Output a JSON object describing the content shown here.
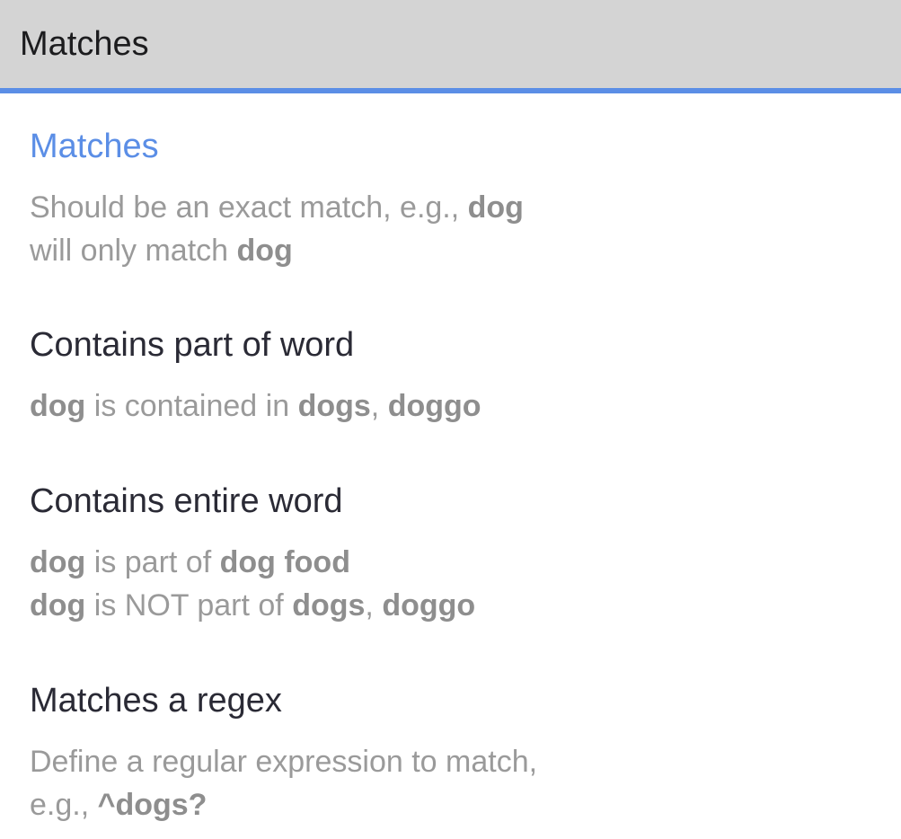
{
  "header": {
    "title": "Matches"
  },
  "accent_color": "#5b8ee6",
  "options": [
    {
      "title": "Matches",
      "selected": true,
      "desc_lines": [
        [
          {
            "t": "Should be an exact match, e.g., ",
            "b": false
          },
          {
            "t": "dog",
            "b": true
          }
        ],
        [
          {
            "t": "will only match ",
            "b": false
          },
          {
            "t": "dog",
            "b": true
          }
        ]
      ]
    },
    {
      "title": "Contains part of word",
      "selected": false,
      "desc_lines": [
        [
          {
            "t": "dog",
            "b": true
          },
          {
            "t": " is contained in ",
            "b": false
          },
          {
            "t": "dogs",
            "b": true
          },
          {
            "t": ", ",
            "b": false
          },
          {
            "t": "doggo",
            "b": true
          }
        ]
      ]
    },
    {
      "title": "Contains entire word",
      "selected": false,
      "desc_lines": [
        [
          {
            "t": "dog",
            "b": true
          },
          {
            "t": " is part of ",
            "b": false
          },
          {
            "t": "dog food",
            "b": true
          }
        ],
        [
          {
            "t": "dog",
            "b": true
          },
          {
            "t": " is NOT part of ",
            "b": false
          },
          {
            "t": "dogs",
            "b": true
          },
          {
            "t": ", ",
            "b": false
          },
          {
            "t": "doggo",
            "b": true
          }
        ]
      ]
    },
    {
      "title": "Matches a regex",
      "selected": false,
      "desc_lines": [
        [
          {
            "t": "Define a regular expression to match,",
            "b": false
          }
        ],
        [
          {
            "t": "e.g., ",
            "b": false
          },
          {
            "t": "^dogs?",
            "b": true
          }
        ]
      ]
    }
  ]
}
